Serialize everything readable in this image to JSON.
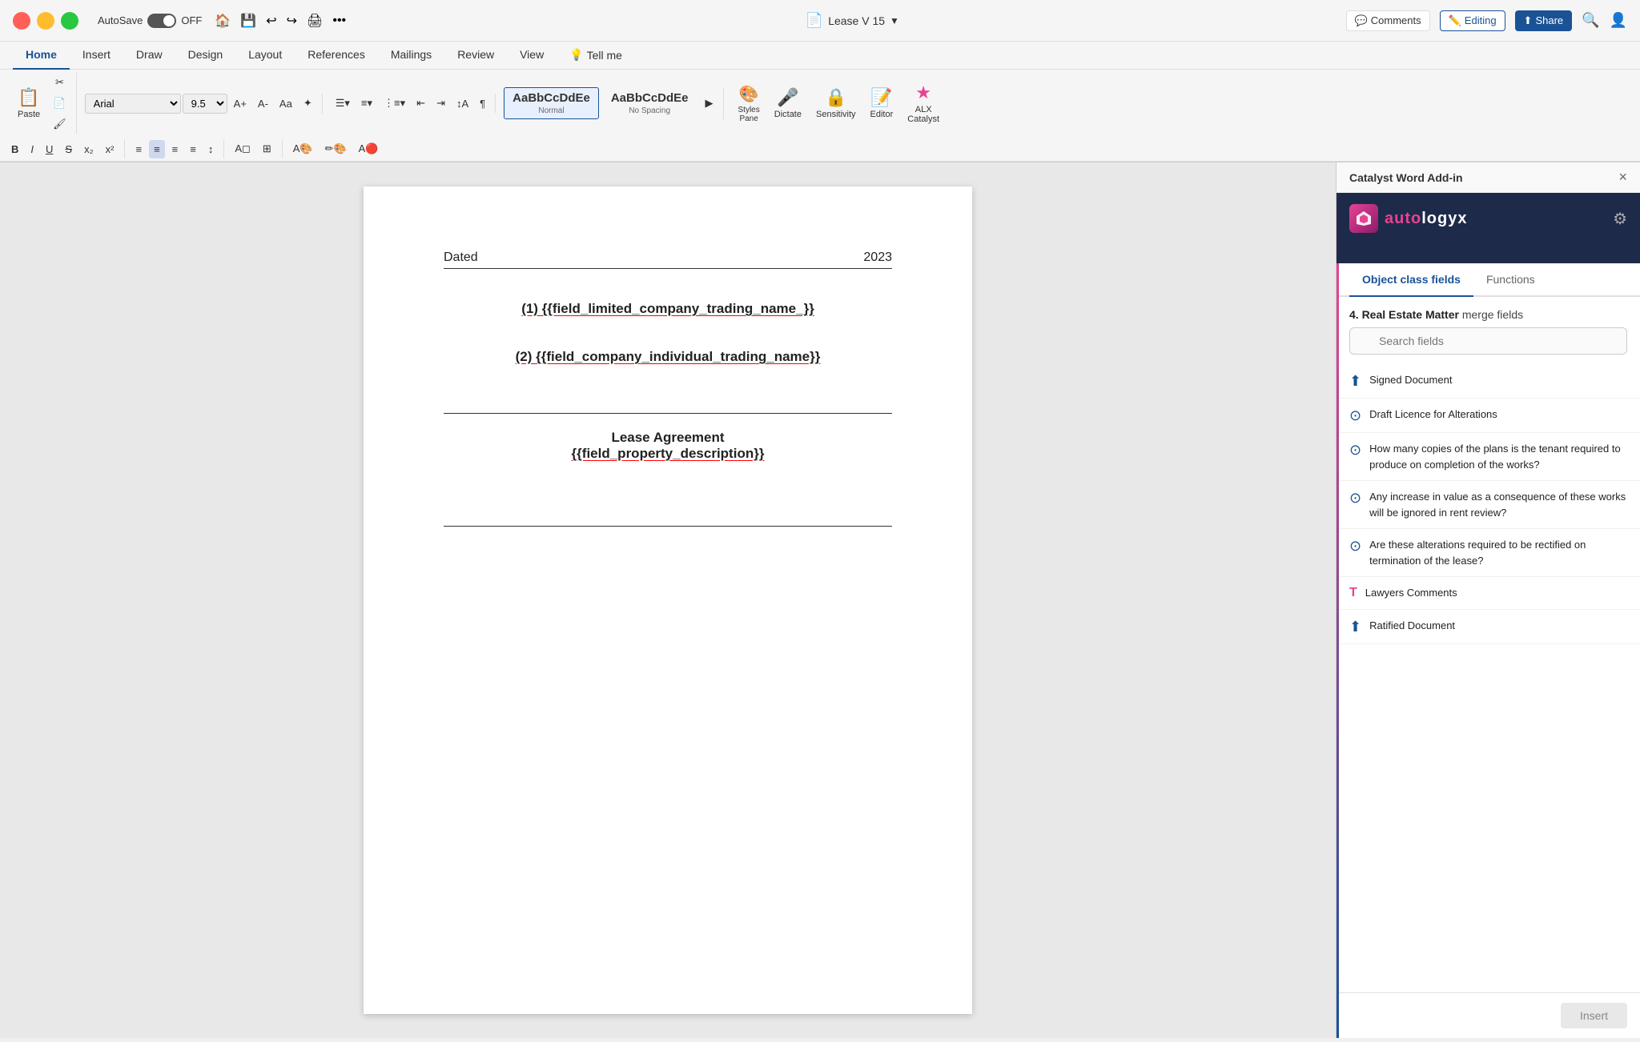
{
  "titleBar": {
    "autosave": "AutoSave",
    "toggle": "OFF",
    "docTitle": "Lease V 15",
    "icons": [
      "home",
      "save",
      "undo",
      "redo",
      "print",
      "more"
    ]
  },
  "ribbon": {
    "tabs": [
      "Home",
      "Insert",
      "Draw",
      "Design",
      "Layout",
      "References",
      "Mailings",
      "Review",
      "View",
      "Tell me"
    ],
    "activeTab": "Home",
    "font": "Arial",
    "fontSize": "9.5",
    "styles": [
      {
        "preview": "AaBbCcDdEe",
        "label": "Normal",
        "active": true
      },
      {
        "preview": "AaBbCcDdEe",
        "label": "No Spacing",
        "active": false
      }
    ],
    "rightButtons": [
      "Comments",
      "Editing",
      "Share"
    ]
  },
  "rightPanel": {
    "title": "Catalyst Word Add-in",
    "logoText": "autologyx",
    "tabs": [
      "Object class fields",
      "Functions"
    ],
    "activeTab": "Object class fields",
    "sectionLabel": "4. Real Estate Matter",
    "sectionSuffix": "merge fields",
    "searchPlaceholder": "Search fields",
    "closeBtn": "×",
    "insertBtn": "Insert",
    "fields": [
      {
        "icon": "upload",
        "iconType": "upload",
        "text": "Signed Document"
      },
      {
        "icon": "circle",
        "iconType": "circle",
        "text": "Draft Licence for Alterations"
      },
      {
        "icon": "circle",
        "iconType": "circle",
        "text": "How many copies of the plans is the tenant required to produce on completion of the works?"
      },
      {
        "icon": "circle",
        "iconType": "circle",
        "text": "Any increase in value as a consequence of these works will be ignored in rent review?"
      },
      {
        "icon": "circle",
        "iconType": "circle",
        "text": "Are these alterations required to be rectified on termination of the lease?"
      },
      {
        "icon": "text",
        "iconType": "text-icon",
        "text": "Lawyers Comments"
      },
      {
        "icon": "arrow-up",
        "iconType": "arrow-up",
        "text": "Ratified Document"
      }
    ]
  },
  "document": {
    "dated": "Dated",
    "year": "2023",
    "field1": "(1) {{field_limited_company_trading_name_}}",
    "field2": "(2) {{field_company_individual_trading_name}}",
    "sectionTitle": "Lease Agreement",
    "field3": "{{field_property_description}}"
  }
}
